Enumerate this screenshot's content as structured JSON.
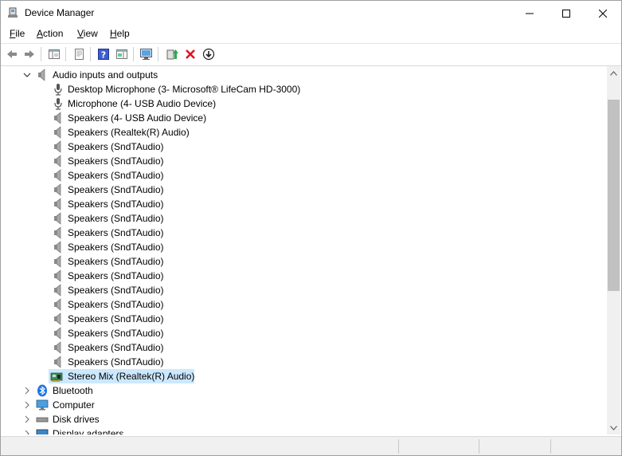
{
  "window": {
    "title": "Device Manager"
  },
  "menu": [
    {
      "key": "F",
      "rest": "ile"
    },
    {
      "key": "A",
      "rest": "ction"
    },
    {
      "key": "V",
      "rest": "iew"
    },
    {
      "key": "H",
      "rest": "elp"
    }
  ],
  "toolbar": {
    "icons": [
      "back-icon",
      "forward-icon",
      "show-hide-console-tree-icon",
      "properties-icon",
      "help-icon",
      "action-pane-icon",
      "scan-hardware-icon",
      "update-driver-icon",
      "uninstall-device-icon",
      "disable-device-icon"
    ]
  },
  "tree": {
    "category_audio": "Audio inputs and outputs",
    "devices": [
      "Desktop Microphone (3- Microsoft® LifeCam HD-3000)",
      "Microphone (4- USB Audio Device)",
      "Speakers (4- USB Audio Device)",
      "Speakers (Realtek(R) Audio)",
      "Speakers (SndTAudio)",
      "Speakers (SndTAudio)",
      "Speakers (SndTAudio)",
      "Speakers (SndTAudio)",
      "Speakers (SndTAudio)",
      "Speakers (SndTAudio)",
      "Speakers (SndTAudio)",
      "Speakers (SndTAudio)",
      "Speakers (SndTAudio)",
      "Speakers (SndTAudio)",
      "Speakers (SndTAudio)",
      "Speakers (SndTAudio)",
      "Speakers (SndTAudio)",
      "Speakers (SndTAudio)",
      "Speakers (SndTAudio)",
      "Speakers (SndTAudio)",
      "Stereo Mix (Realtek(R) Audio)"
    ],
    "categories_after": [
      "Bluetooth",
      "Computer",
      "Disk drives",
      "Display adapters"
    ]
  },
  "colors": {
    "selection": "#cce8ff",
    "uninstall_red": "#e81123"
  }
}
